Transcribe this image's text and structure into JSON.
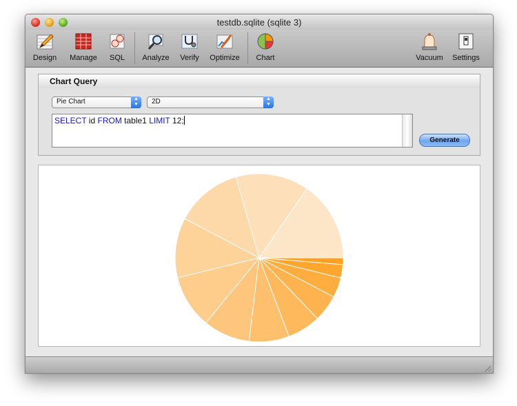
{
  "window": {
    "title": "testdb.sqlite (sqlite 3)"
  },
  "toolbar": {
    "items": [
      {
        "label": "Design",
        "icon": "pencil-ruler-icon"
      },
      {
        "label": "Manage",
        "icon": "table-grid-icon"
      },
      {
        "label": "SQL",
        "icon": "magnifier-gear-icon"
      },
      {
        "label": "Analyze",
        "icon": "magnifying-glass-icon"
      },
      {
        "label": "Verify",
        "icon": "stethoscope-icon"
      },
      {
        "label": "Optimize",
        "icon": "wrench-icon"
      },
      {
        "label": "Chart",
        "icon": "pie-chart-icon"
      },
      {
        "label": "Vacuum",
        "icon": "bell-jar-icon"
      },
      {
        "label": "Settings",
        "icon": "switch-icon"
      }
    ]
  },
  "panel": {
    "title": "Chart Query",
    "chart_type": "Pie Chart",
    "dimension": "2D",
    "query": {
      "kw_select": "SELECT",
      "col": " id ",
      "kw_from": "FROM",
      "table": " table1 ",
      "kw_limit": "LIMIT",
      "rest": " 12;"
    },
    "generate_label": "Generate"
  },
  "colors": {
    "slices_start": "#fde6c8",
    "slices_end": "#ffa020",
    "keyword": "#1a1ab8"
  },
  "chart_data": {
    "type": "pie",
    "title": "",
    "values": [
      12,
      11,
      10,
      9,
      8,
      7,
      6,
      5,
      4,
      3,
      2,
      1
    ],
    "start_angle_deg": 0,
    "direction": "counterclockwise-from-east"
  }
}
